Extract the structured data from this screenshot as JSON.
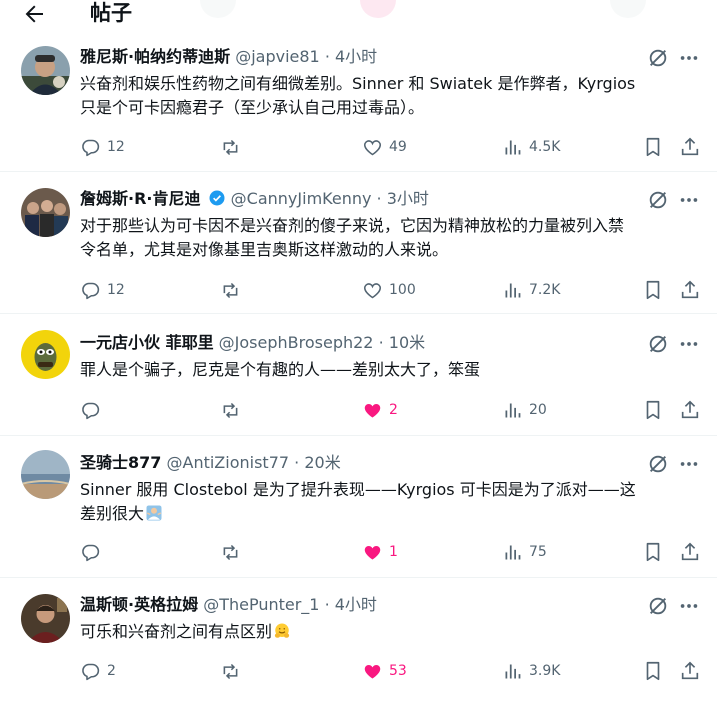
{
  "header": {
    "title": "帖子"
  },
  "posts": [
    {
      "name": "雅尼斯·帕纳约蒂迪斯",
      "handle": "@japvie81",
      "time": "4小时",
      "verified": false,
      "lines": [
        "兴奋剂和娱乐性药物之间有细微差别。Sinner 和 Swiatek 是作弊者，Kyrgios",
        "只是个可卡因瘾君子（至少承认自己用过毒品）。"
      ],
      "replies": "12",
      "reposts": "",
      "likes": "49",
      "liked": false,
      "views": "4.5K"
    },
    {
      "name": "詹姆斯·R·肯尼迪",
      "handle": "@CannyJimKenny",
      "time": "3小时",
      "verified": true,
      "lines": [
        "对于那些认为可卡因不是兴奋剂的傻子来说，它因为精神放松的力量被列入禁",
        "令名单，尤其是对像基里吉奥斯这样激动的人来说。"
      ],
      "replies": "12",
      "reposts": "",
      "likes": "100",
      "liked": false,
      "views": "7.2K"
    },
    {
      "name": "一元店小伙 菲耶里",
      "handle": "@JosephBroseph22",
      "time": "10米",
      "verified": false,
      "lines": [
        "罪人是个骗子，尼克是个有趣的人——差别太大了，笨蛋"
      ],
      "replies": "",
      "reposts": "",
      "likes": "2",
      "liked": true,
      "views": "20"
    },
    {
      "name": "圣骑士877",
      "handle": "@AntiZionist77",
      "time": "20米",
      "verified": false,
      "lines": [
        "Sinner 服用 Clostebol 是为了提升表现——Kyrgios 可卡因是为了派对——这",
        "差别很大"
      ],
      "emoji": "person-shrugging-emoji",
      "replies": "",
      "reposts": "",
      "likes": "1",
      "liked": true,
      "views": "75"
    },
    {
      "name": "温斯顿·英格拉姆",
      "handle": "@ThePunter_1",
      "time": "4小时",
      "verified": false,
      "lines": [
        "可乐和兴奋剂之间有点区别"
      ],
      "emoji": "hugging-face-emoji",
      "replies": "2",
      "reposts": "",
      "likes": "53",
      "liked": true,
      "views": "3.9K"
    }
  ],
  "colors": {
    "text": "#0f1419",
    "secondary": "#536471",
    "like": "#f91880",
    "verified": "#1d9bf0",
    "divider": "#eff3f4"
  },
  "icons": [
    "back-arrow-icon",
    "grok-icon",
    "more-icon",
    "reply-icon",
    "repost-icon",
    "like-icon",
    "views-icon",
    "bookmark-icon",
    "share-icon",
    "verified-badge-icon"
  ]
}
